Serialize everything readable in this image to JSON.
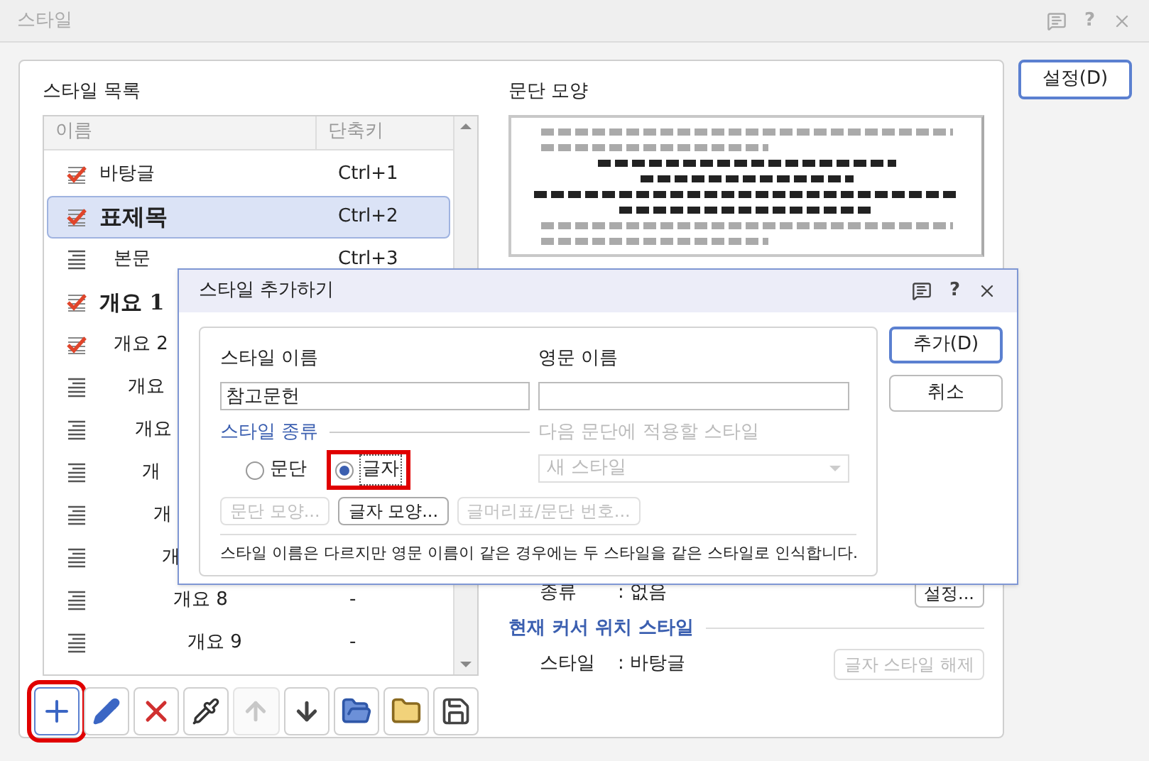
{
  "window": {
    "title": "스타일",
    "help_glyph": "?"
  },
  "settings_button": "설정(D)",
  "style_list": {
    "title": "스타일 목록",
    "columns": [
      "이름",
      "단축키"
    ],
    "items": [
      {
        "name": "바탕글",
        "shortcut": "Ctrl+1",
        "kind": "character",
        "selected": false
      },
      {
        "name": "표제목",
        "shortcut": "Ctrl+2",
        "kind": "character",
        "selected": true
      },
      {
        "name": "본문",
        "shortcut": "Ctrl+3",
        "kind": "paragraph",
        "selected": false
      },
      {
        "name": "개요 1",
        "kind": "character",
        "selected": false
      },
      {
        "name": "개요 2",
        "kind": "character",
        "selected": false
      },
      {
        "name": "개요",
        "kind": "paragraph",
        "selected": false
      },
      {
        "name": "개요",
        "kind": "paragraph",
        "selected": false
      },
      {
        "name": "개",
        "kind": "paragraph",
        "selected": false
      },
      {
        "name": "개",
        "kind": "paragraph",
        "selected": false
      },
      {
        "name": "개",
        "kind": "paragraph",
        "selected": false
      },
      {
        "name": "개요 8",
        "shortcut": "-",
        "kind": "paragraph",
        "selected": false
      },
      {
        "name": "개요 9",
        "shortcut": "-",
        "kind": "paragraph",
        "selected": false
      }
    ]
  },
  "preview": {
    "title": "문단 모양"
  },
  "style_kind_row": {
    "label": "종류",
    "value": ": 없음",
    "button": "설정..."
  },
  "cursor_style": {
    "title": "현재 커서 위치 스타일",
    "label": "스타일",
    "value": ": 바탕글",
    "button": "글자 스타일 해제",
    "button_disabled": true
  },
  "tools": [
    {
      "kind": "add",
      "disabled": false,
      "highlighted": true
    },
    {
      "kind": "edit",
      "disabled": false,
      "highlighted": false
    },
    {
      "kind": "delete",
      "disabled": false,
      "highlighted": false
    },
    {
      "kind": "pick",
      "disabled": false,
      "highlighted": false
    },
    {
      "kind": "up",
      "disabled": true,
      "highlighted": false
    },
    {
      "kind": "down",
      "disabled": false,
      "highlighted": false
    },
    {
      "kind": "import",
      "disabled": false,
      "highlighted": false
    },
    {
      "kind": "open",
      "disabled": false,
      "highlighted": false
    },
    {
      "kind": "save",
      "disabled": false,
      "highlighted": false
    }
  ],
  "dialog": {
    "title": "스타일 추가하기",
    "help_glyph": "?",
    "name_label": "스타일 이름",
    "name_value": "참고문헌",
    "english_label": "영문 이름",
    "kind_label": "스타일 종류",
    "kinds": [
      {
        "label": "문단",
        "selected": false,
        "highlighted": false
      },
      {
        "label": "글자",
        "selected": true,
        "highlighted": true
      }
    ],
    "next_label": "다음 문단에 적용할 스타일",
    "next_value": "새 스타일",
    "next_disabled": true,
    "format_buttons": [
      {
        "label": "문단 모양...",
        "disabled": true
      },
      {
        "label": "글자 모양...",
        "disabled": false
      },
      {
        "label": "글머리표/문단 번호...",
        "disabled": true
      }
    ],
    "note": "스타일 이름은 다르지만 영문 이름이 같은 경우에는 두 스타일을 같은 스타일로 인식합니다.",
    "buttons": [
      {
        "label": "추가(D)",
        "default": true
      },
      {
        "label": "취소",
        "default": false
      }
    ]
  }
}
